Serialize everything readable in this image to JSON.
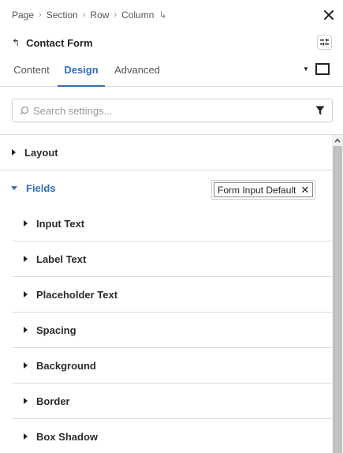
{
  "breadcrumb": {
    "items": [
      "Page",
      "Section",
      "Row",
      "Column"
    ],
    "separator": "›",
    "jump_glyph": "↳"
  },
  "header": {
    "back_glyph": "↰",
    "title": "Contact Form"
  },
  "tabs": [
    {
      "label": "Content",
      "active": false
    },
    {
      "label": "Design",
      "active": true
    },
    {
      "label": "Advanced",
      "active": false
    }
  ],
  "search": {
    "placeholder": "Search settings...",
    "value": ""
  },
  "sections": {
    "layout": {
      "label": "Layout"
    },
    "fields": {
      "label": "Fields",
      "preset_label": "Form Input Default",
      "preset_remove_glyph": "✕",
      "items": [
        {
          "label": "Input Text"
        },
        {
          "label": "Label Text"
        },
        {
          "label": "Placeholder Text"
        },
        {
          "label": "Spacing"
        },
        {
          "label": "Background"
        },
        {
          "label": "Border"
        },
        {
          "label": "Box Shadow"
        }
      ]
    }
  },
  "icons": {
    "close": "close-icon",
    "preset": "preset-toggle-icon",
    "search": "search-icon",
    "filter": "filter-icon",
    "device": "desktop-icon"
  },
  "colors": {
    "accent": "#2f6fb6",
    "text": "#2b2b2b",
    "border": "#dcdcdc"
  }
}
